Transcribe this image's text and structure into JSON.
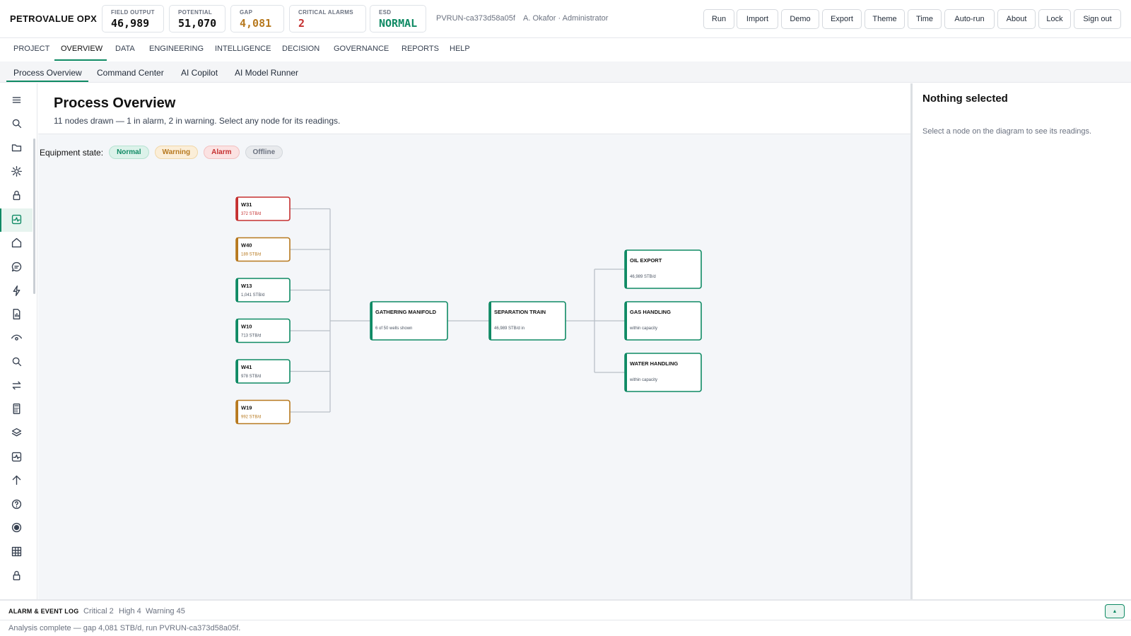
{
  "app": {
    "brand": "PETROVALUE OPX"
  },
  "kpis": [
    {
      "label": "FIELD OUTPUT",
      "value": "46,989",
      "tone": "normal"
    },
    {
      "label": "POTENTIAL",
      "value": "51,070",
      "tone": "normal"
    },
    {
      "label": "GAP",
      "value": "4,081",
      "tone": "amber"
    },
    {
      "label": "CRITICAL ALARMS",
      "value": "2",
      "tone": "red"
    },
    {
      "label": "ESD",
      "value": "NORMAL",
      "tone": "green"
    }
  ],
  "header": {
    "run_id": "PVRUN-ca373d58a05f",
    "user": "A. Okafor · Administrator",
    "buttons": [
      "Run",
      "Import",
      "Demo",
      "Export",
      "Theme",
      "Time",
      "Auto-run",
      "About",
      "Lock",
      "Sign out"
    ]
  },
  "nav_primary": [
    "PROJECT",
    "OVERVIEW",
    "DATA",
    "ENGINEERING",
    "INTELLIGENCE",
    "DECISION",
    "GOVERNANCE",
    "REPORTS",
    "HELP"
  ],
  "nav_primary_active": "OVERVIEW",
  "nav_secondary": [
    "Process Overview",
    "Command Center",
    "AI Copilot",
    "AI Model Runner"
  ],
  "nav_secondary_active": "Process Overview",
  "rail_icons": [
    "menu-icon",
    "search-icon",
    "folder-icon",
    "gear-icon",
    "lock-icon",
    "activity-icon",
    "home-icon",
    "chat-icon",
    "bolt-icon",
    "report-icon",
    "eye-icon",
    "search-icon",
    "swap-icon",
    "calculator-icon",
    "layers-icon",
    "pulse-icon",
    "arrow-up-icon",
    "help-icon",
    "record-icon",
    "grid-icon",
    "lock-icon"
  ],
  "page": {
    "title": "Process Overview",
    "subtitle": "11 nodes drawn — 1 in alarm, 2 in warning. Select any node for its readings."
  },
  "legend": {
    "label": "Equipment state:",
    "states": [
      "Normal",
      "Warning",
      "Alarm",
      "Offline"
    ]
  },
  "colors": {
    "normal": "#0f8a64",
    "warning": "#b7791f",
    "alarm": "#c53030",
    "offline": "#6b7280",
    "accent": "#0f8a64"
  },
  "wells": [
    {
      "name": "W31",
      "rate": "372 STB/d",
      "state": "alarm"
    },
    {
      "name": "W40",
      "rate": "189 STB/d",
      "state": "warning"
    },
    {
      "name": "W13",
      "rate": "1,041 STB/d",
      "state": "normal"
    },
    {
      "name": "W10",
      "rate": "713 STB/d",
      "state": "normal"
    },
    {
      "name": "W41",
      "rate": "978 STB/d",
      "state": "normal"
    },
    {
      "name": "W19",
      "rate": "992 STB/d",
      "state": "warning"
    }
  ],
  "facilities": [
    {
      "name": "GATHERING MANIFOLD",
      "detail": "6 of 50 wells shown",
      "state": "normal"
    },
    {
      "name": "SEPARATION TRAIN",
      "detail": "46,989 STB/d in",
      "state": "normal"
    }
  ],
  "outputs": [
    {
      "name": "OIL EXPORT",
      "detail": "46,989 STB/d",
      "state": "normal"
    },
    {
      "name": "GAS HANDLING",
      "detail": "within capacity",
      "state": "normal"
    },
    {
      "name": "WATER HANDLING",
      "detail": "within capacity",
      "state": "normal"
    }
  ],
  "inspector": {
    "title": "Nothing selected",
    "hint": "Select a node on the diagram to see its readings."
  },
  "alarm_log": {
    "title": "ALARM & EVENT LOG",
    "critical": "Critical 2",
    "high": "High 4",
    "warning": "Warning 45"
  },
  "status": {
    "message": "Analysis complete — gap 4,081 STB/d, run PVRUN-ca373d58a05f."
  }
}
